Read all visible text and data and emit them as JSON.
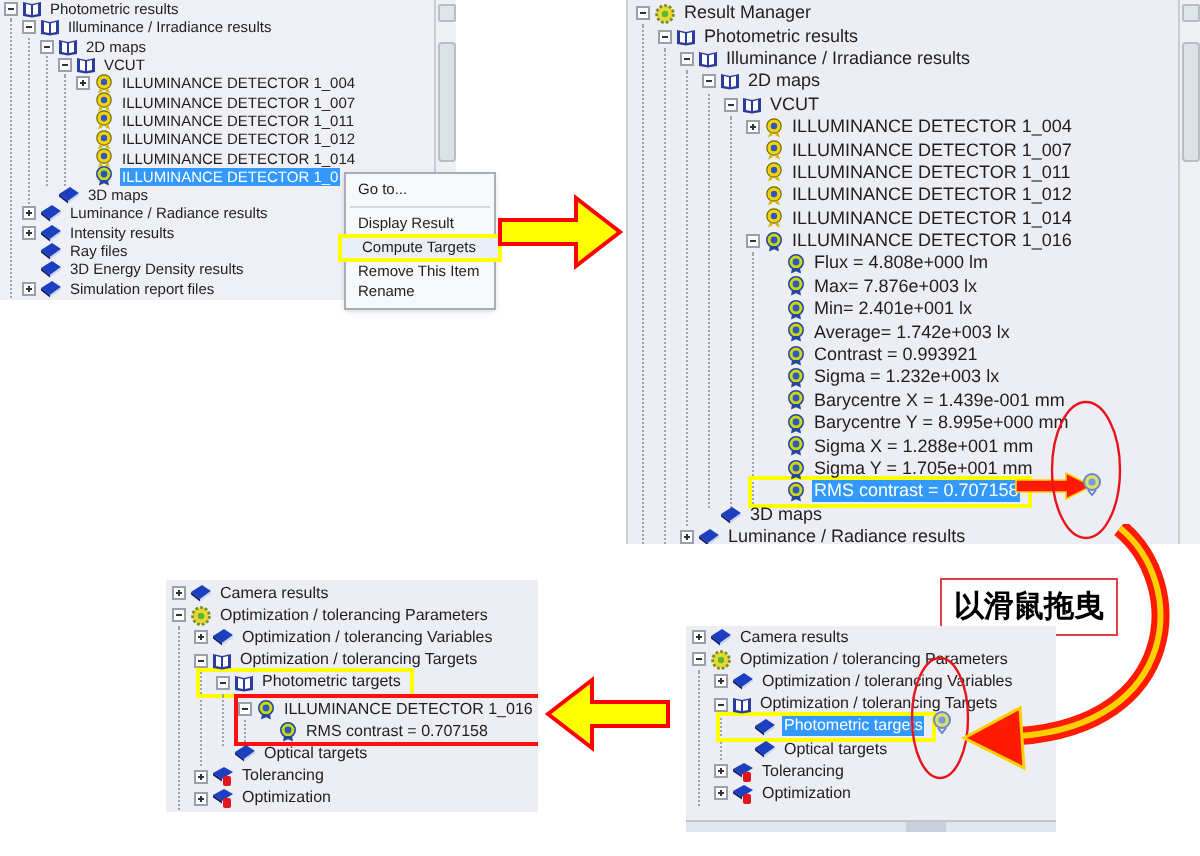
{
  "panel_top_left": {
    "tree": [
      {
        "label": "Photometric results",
        "kind": "book-open",
        "expanded": true,
        "selected": false,
        "highlighted": false,
        "children": [
          {
            "label": "Illuminance / Irradiance results",
            "kind": "book-open",
            "expanded": true,
            "selected": false,
            "highlighted": false,
            "children": [
              {
                "label": "2D maps",
                "kind": "book-open",
                "expanded": true,
                "selected": false,
                "highlighted": false,
                "children": [
                  {
                    "label": "VCUT",
                    "kind": "book-open",
                    "expanded": true,
                    "selected": false,
                    "highlighted": false,
                    "children": [
                      {
                        "label": "ILLUMINANCE DETECTOR 1_004",
                        "kind": "detector",
                        "expanded": false,
                        "selected": false,
                        "highlighted": false
                      },
                      {
                        "label": "ILLUMINANCE DETECTOR 1_007",
                        "kind": "detector",
                        "selected": false,
                        "highlighted": false
                      },
                      {
                        "label": "ILLUMINANCE DETECTOR 1_011",
                        "kind": "detector",
                        "selected": false,
                        "highlighted": false
                      },
                      {
                        "label": "ILLUMINANCE DETECTOR 1_012",
                        "kind": "detector",
                        "selected": false,
                        "highlighted": false
                      },
                      {
                        "label": "ILLUMINANCE DETECTOR 1_014",
                        "kind": "detector",
                        "selected": false,
                        "highlighted": false
                      },
                      {
                        "label": "ILLUMINANCE DETECTOR 1_0",
                        "kind": "result",
                        "selected": true,
                        "highlighted": false
                      }
                    ]
                  }
                ]
              },
              {
                "label": "3D maps",
                "kind": "book",
                "selected": false,
                "highlighted": false
              }
            ]
          },
          {
            "label": "Luminance / Radiance results",
            "kind": "book",
            "expanded": false,
            "selected": false,
            "highlighted": false
          },
          {
            "label": "Intensity results",
            "kind": "book",
            "expanded": false,
            "selected": false,
            "highlighted": false
          },
          {
            "label": "Ray files",
            "kind": "book",
            "selected": false,
            "highlighted": false
          },
          {
            "label": "3D Energy Density results",
            "kind": "book",
            "selected": false,
            "highlighted": false
          },
          {
            "label": "Simulation report files",
            "kind": "book",
            "expanded": false,
            "selected": false,
            "highlighted": false
          }
        ]
      }
    ],
    "context_menu": [
      {
        "kind": "item",
        "label": "Go to...",
        "selected": false
      },
      {
        "kind": "separator"
      },
      {
        "kind": "item",
        "label": "Display Result",
        "selected": false
      },
      {
        "kind": "item",
        "label": "Compute Targets",
        "selected": true
      },
      {
        "kind": "item",
        "label": "Remove This Item",
        "selected": false
      },
      {
        "kind": "item",
        "label": "Rename",
        "selected": false
      }
    ]
  },
  "panel_top_right": {
    "tree": [
      {
        "label": "Result Manager",
        "kind": "manager",
        "expanded": true,
        "selected": false,
        "highlighted": false,
        "children": [
          {
            "label": "Photometric results",
            "kind": "book-open",
            "expanded": true,
            "selected": false,
            "highlighted": false,
            "children": [
              {
                "label": "Illuminance / Irradiance results",
                "kind": "book-open",
                "expanded": true,
                "selected": false,
                "highlighted": false,
                "children": [
                  {
                    "label": "2D maps",
                    "kind": "book-open",
                    "expanded": true,
                    "selected": false,
                    "highlighted": false,
                    "children": [
                      {
                        "label": "VCUT",
                        "kind": "book-open",
                        "expanded": true,
                        "selected": false,
                        "highlighted": false,
                        "children": [
                          {
                            "label": "ILLUMINANCE DETECTOR 1_004",
                            "kind": "detector",
                            "expanded": false,
                            "selected": false,
                            "highlighted": false
                          },
                          {
                            "label": "ILLUMINANCE DETECTOR 1_007",
                            "kind": "detector",
                            "selected": false,
                            "highlighted": false
                          },
                          {
                            "label": "ILLUMINANCE DETECTOR 1_011",
                            "kind": "detector",
                            "selected": false,
                            "highlighted": false
                          },
                          {
                            "label": "ILLUMINANCE DETECTOR 1_012",
                            "kind": "detector",
                            "selected": false,
                            "highlighted": false
                          },
                          {
                            "label": "ILLUMINANCE DETECTOR 1_014",
                            "kind": "detector",
                            "selected": false,
                            "highlighted": false
                          },
                          {
                            "label": "ILLUMINANCE DETECTOR 1_016",
                            "kind": "result",
                            "expanded": true,
                            "selected": false,
                            "highlighted": false,
                            "children": [
                              {
                                "label": "Flux = 4.808e+000 lm",
                                "kind": "result",
                                "selected": false,
                                "highlighted": false
                              },
                              {
                                "label": "Max= 7.876e+003 lx",
                                "kind": "result",
                                "selected": false,
                                "highlighted": false
                              },
                              {
                                "label": "Min= 2.401e+001 lx",
                                "kind": "result",
                                "selected": false,
                                "highlighted": false
                              },
                              {
                                "label": "Average= 1.742e+003 lx",
                                "kind": "result",
                                "selected": false,
                                "highlighted": false
                              },
                              {
                                "label": "Contrast = 0.993921",
                                "kind": "result",
                                "selected": false,
                                "highlighted": false
                              },
                              {
                                "label": "Sigma = 1.232e+003 lx",
                                "kind": "result",
                                "selected": false,
                                "highlighted": false
                              },
                              {
                                "label": "Barycentre X = 1.439e-001 mm",
                                "kind": "result",
                                "selected": false,
                                "highlighted": false
                              },
                              {
                                "label": "Barycentre Y = 8.995e+000 mm",
                                "kind": "result",
                                "selected": false,
                                "highlighted": false
                              },
                              {
                                "label": "Sigma X = 1.288e+001 mm",
                                "kind": "result",
                                "selected": false,
                                "highlighted": false
                              },
                              {
                                "label": "Sigma Y = 1.705e+001 mm",
                                "kind": "result",
                                "selected": false,
                                "highlighted": false
                              },
                              {
                                "label": "RMS contrast = 0.707158",
                                "kind": "result",
                                "selected": true,
                                "highlighted": true
                              }
                            ]
                          }
                        ]
                      }
                    ]
                  },
                  {
                    "label": "3D maps",
                    "kind": "book",
                    "selected": false,
                    "highlighted": false
                  }
                ]
              },
              {
                "label": "Luminance / Radiance results",
                "kind": "book",
                "expanded": false,
                "selected": false,
                "highlighted": false
              }
            ]
          }
        ]
      }
    ]
  },
  "drag_label": "以滑鼠拖曳",
  "panel_bottom_right": {
    "tree": [
      {
        "label": "Camera results",
        "kind": "book",
        "expanded": false,
        "selected": false,
        "highlighted": false
      },
      {
        "label": "Optimization / tolerancing Parameters",
        "kind": "manager",
        "expanded": true,
        "selected": false,
        "highlighted": false,
        "children": [
          {
            "label": "Optimization / tolerancing Variables",
            "kind": "book",
            "expanded": false,
            "selected": false,
            "highlighted": false
          },
          {
            "label": "Optimization / tolerancing Targets",
            "kind": "book-open",
            "expanded": true,
            "selected": false,
            "highlighted": false,
            "children": [
              {
                "label": "Photometric targets",
                "kind": "book",
                "selected": true,
                "highlighted": true
              },
              {
                "label": "Optical targets",
                "kind": "book",
                "selected": false,
                "highlighted": false
              }
            ]
          },
          {
            "label": "Tolerancing",
            "kind": "tolerance",
            "expanded": false,
            "selected": false,
            "highlighted": false
          },
          {
            "label": "Optimization",
            "kind": "tolerance",
            "expanded": false,
            "selected": false,
            "highlighted": false
          }
        ]
      }
    ]
  },
  "panel_bottom_left": {
    "tree": [
      {
        "label": "Camera results",
        "kind": "book",
        "expanded": false,
        "selected": false,
        "highlighted": false,
        "outlined": false
      },
      {
        "label": "Optimization / tolerancing Parameters",
        "kind": "manager",
        "expanded": true,
        "selected": false,
        "highlighted": false,
        "outlined": false,
        "children": [
          {
            "label": "Optimization / tolerancing Variables",
            "kind": "book",
            "expanded": false,
            "selected": false,
            "highlighted": false,
            "outlined": false
          },
          {
            "label": "Optimization / tolerancing Targets",
            "kind": "book-open",
            "expanded": true,
            "selected": false,
            "highlighted": false,
            "outlined": false,
            "children": [
              {
                "label": "Photometric targets",
                "kind": "book-open",
                "expanded": true,
                "selected": false,
                "highlighted": true,
                "outlined": false,
                "children": [
                  {
                    "label": "ILLUMINANCE DETECTOR 1_016",
                    "kind": "result",
                    "expanded": true,
                    "selected": false,
                    "highlighted": false,
                    "outlined": true,
                    "children": [
                      {
                        "label": "RMS contrast = 0.707158",
                        "kind": "result",
                        "selected": false,
                        "highlighted": false,
                        "outlined": false
                      }
                    ]
                  }
                ]
              },
              {
                "label": "Optical targets",
                "kind": "book",
                "selected": false,
                "highlighted": false,
                "outlined": false
              }
            ]
          },
          {
            "label": "Tolerancing",
            "kind": "tolerance",
            "expanded": false,
            "selected": false,
            "highlighted": false,
            "outlined": false
          },
          {
            "label": "Optimization",
            "kind": "tolerance",
            "expanded": false,
            "selected": false,
            "highlighted": false,
            "outlined": false
          }
        ]
      }
    ]
  }
}
